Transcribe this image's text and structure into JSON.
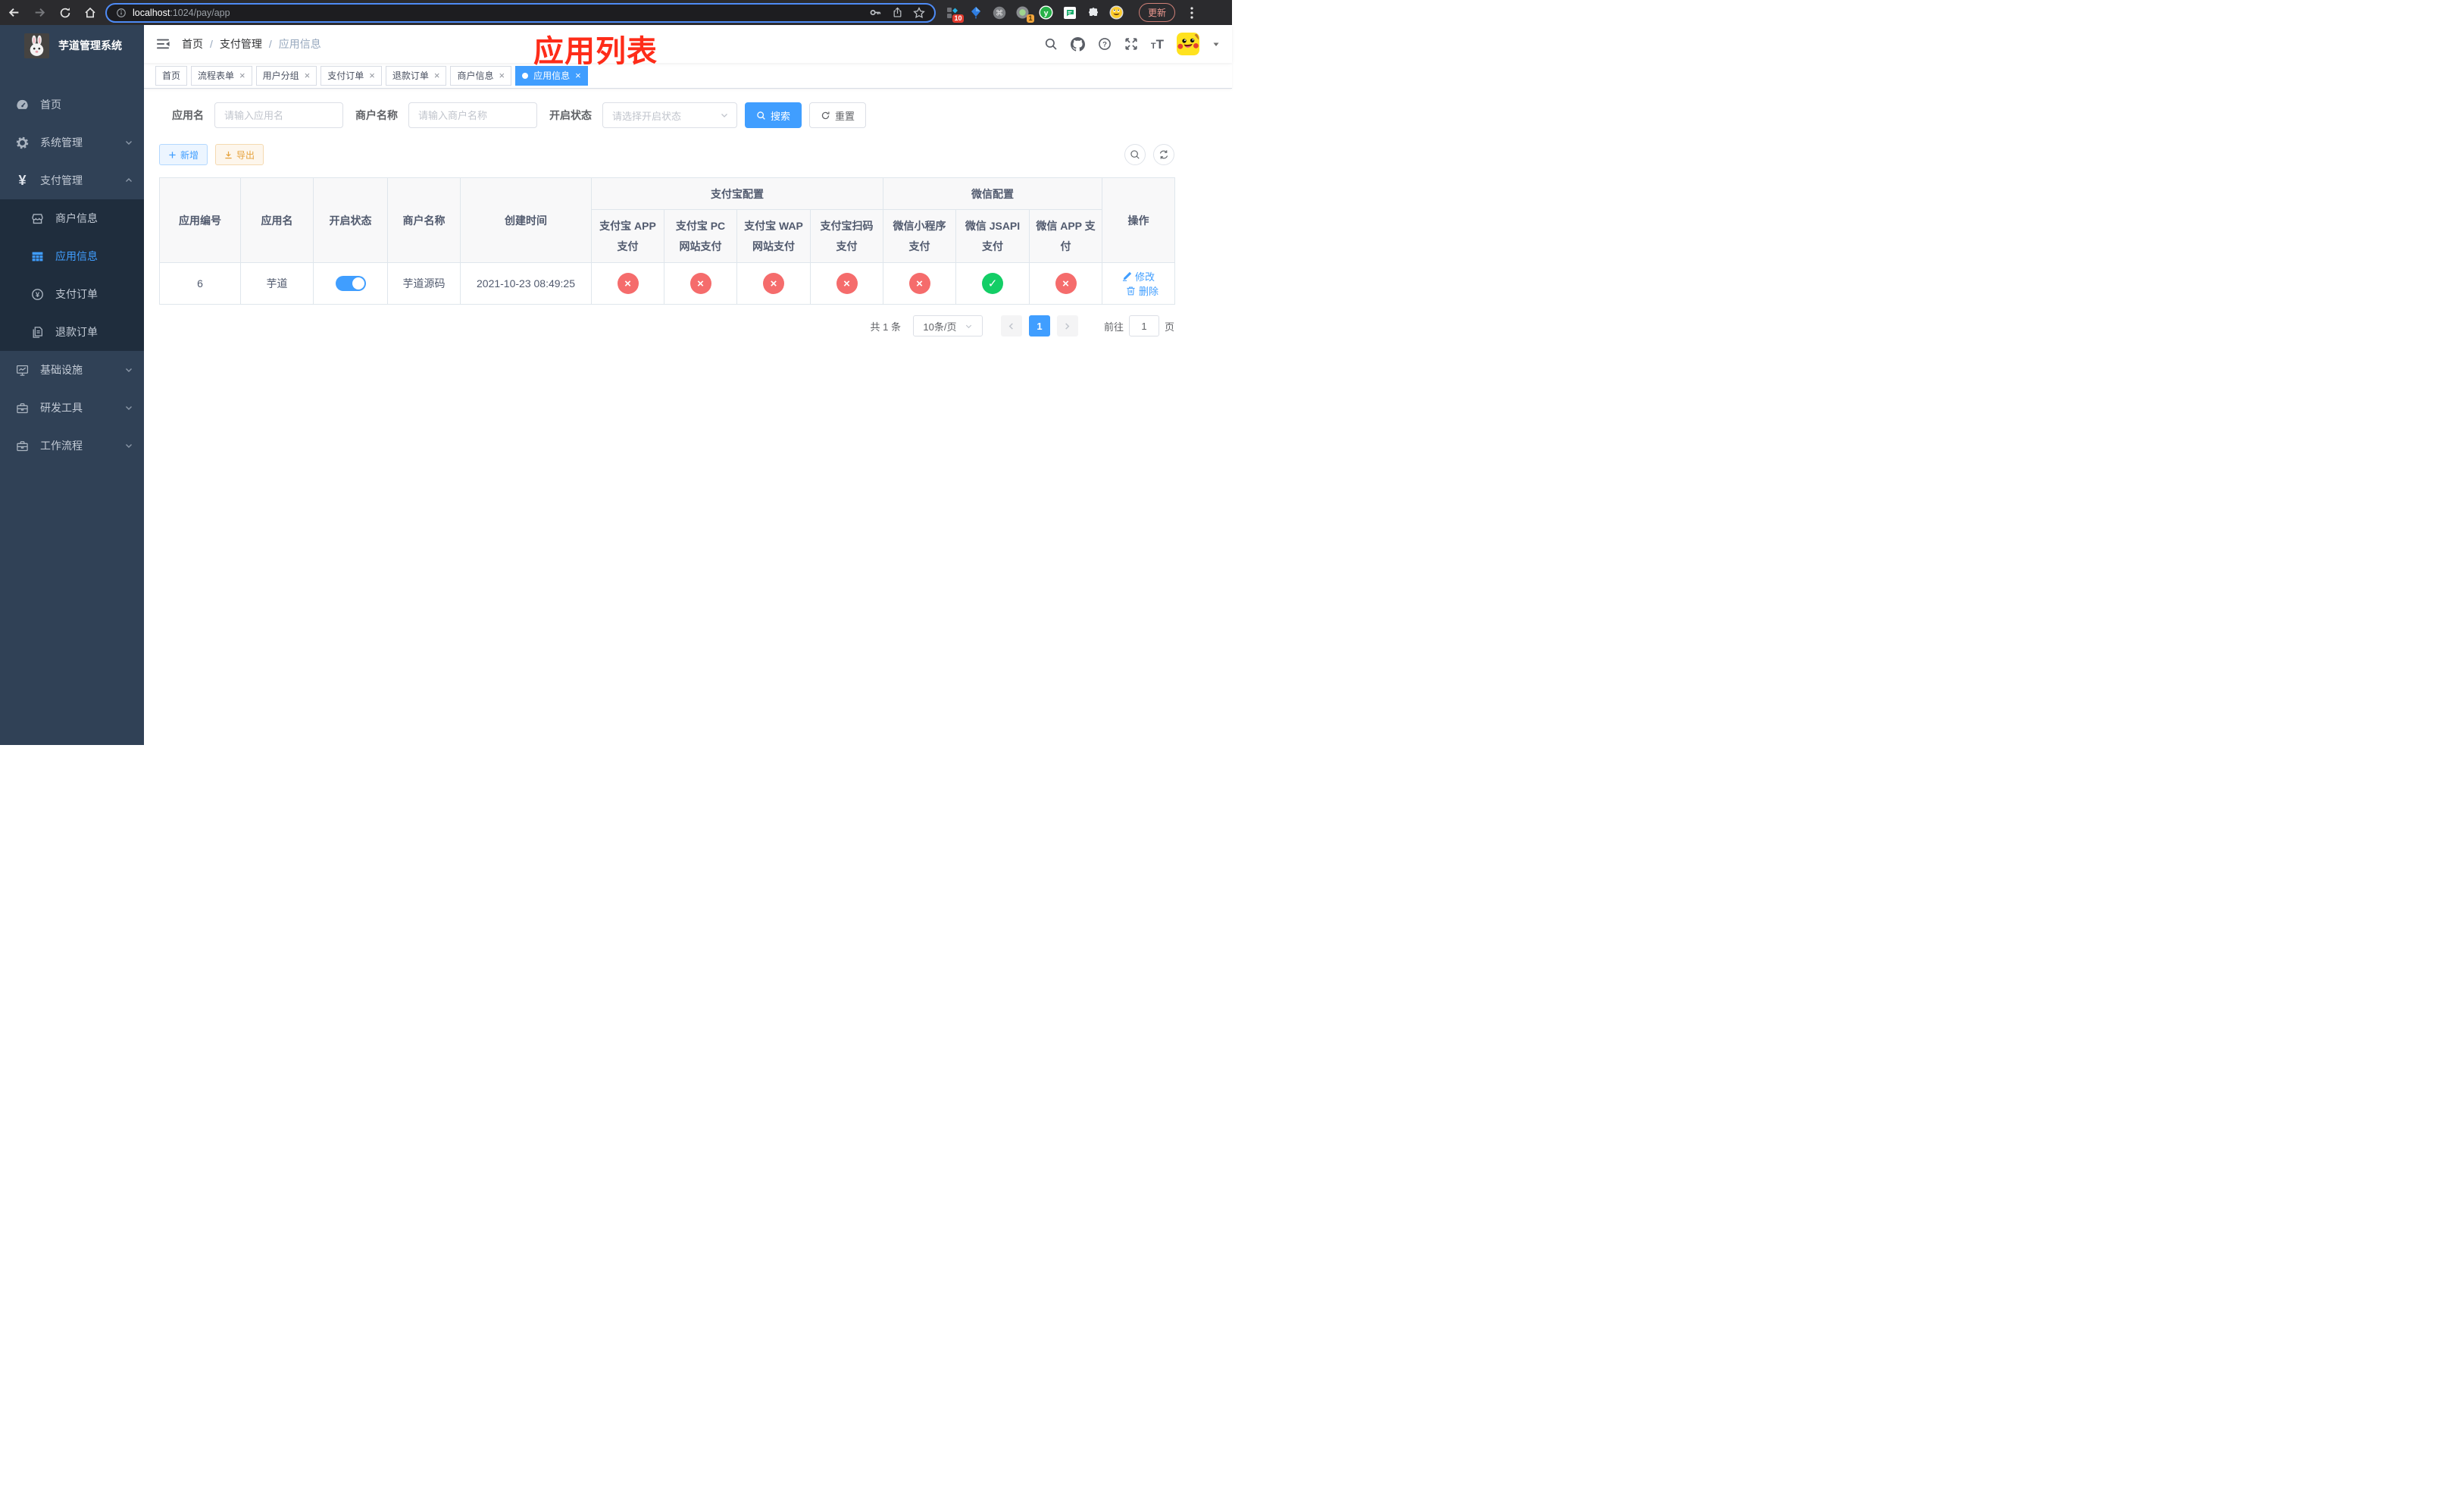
{
  "glyphs": {
    "close": "×",
    "pass": "✓",
    "fail": "×",
    "slash": "/"
  },
  "icons": {
    "yen": "¥",
    "question": "?",
    "command": "⌘",
    "y_extension": "y"
  },
  "browser": {
    "url_host": "localhost",
    "url_path": ":1024/pay/app",
    "extension_badge_a": "10",
    "extension_badge_b": "1",
    "update_button": "更新"
  },
  "sidebar": {
    "logo_title": "芋道管理系统",
    "items": [
      {
        "label": "首页"
      },
      {
        "label": "系统管理"
      },
      {
        "label": "支付管理"
      },
      {
        "label": "商户信息"
      },
      {
        "label": "应用信息"
      },
      {
        "label": "支付订单"
      },
      {
        "label": "退款订单"
      },
      {
        "label": "基础设施"
      },
      {
        "label": "研发工具"
      },
      {
        "label": "工作流程"
      }
    ]
  },
  "navbar": {
    "breadcrumb": [
      "首页",
      "支付管理",
      "应用信息"
    ]
  },
  "annotation": "应用列表",
  "tabs": [
    {
      "label": "首页"
    },
    {
      "label": "流程表单"
    },
    {
      "label": "用户分组"
    },
    {
      "label": "支付订单"
    },
    {
      "label": "退款订单"
    },
    {
      "label": "商户信息"
    },
    {
      "label": "应用信息"
    }
  ],
  "filters": {
    "app_name_label": "应用名",
    "app_name_placeholder": "请输入应用名",
    "merchant_label": "商户名称",
    "merchant_placeholder": "请输入商户名称",
    "status_label": "开启状态",
    "status_placeholder": "请选择开启状态",
    "search_button": "搜索",
    "reset_button": "重置"
  },
  "toolbar": {
    "add_button": "新增",
    "export_button": "导出"
  },
  "table": {
    "headers": {
      "app_id": "应用编号",
      "app_name": "应用名",
      "status": "开启状态",
      "merchant": "商户名称",
      "created_at": "创建时间",
      "alipay_group": "支付宝配置",
      "wechat_group": "微信配置",
      "alipay_app": "支付宝 APP 支付",
      "alipay_pc": "支付宝 PC 网站支付",
      "alipay_wap": "支付宝 WAP 网站支付",
      "alipay_qr": "支付宝扫码支付",
      "wechat_lite": "微信小程序支付",
      "wechat_jsapi": "微信 JSAPI 支付",
      "wechat_app": "微信 APP 支付",
      "actions": "操作"
    },
    "row": {
      "app_id": "6",
      "app_name": "芋道",
      "enabled": true,
      "merchant": "芋道源码",
      "created_at": "2021-10-23 08:49:25",
      "channel_status": [
        false,
        false,
        false,
        false,
        false,
        true,
        false
      ],
      "edit_action": "修改",
      "delete_action": "删除"
    }
  },
  "pagination": {
    "total": "共 1 条",
    "page_size": "10条/页",
    "current_page": "1",
    "goto_label": "前往",
    "goto_value": "1",
    "goto_suffix": "页"
  },
  "colors": {
    "primary": "#409EFF",
    "success": "#13ce66",
    "danger": "#f56c6c",
    "warning": "#E6A23C",
    "sidebar_bg": "#304156",
    "sidebar_sub_bg": "#1f2d3d",
    "annotation_red": "#fe2c19"
  }
}
